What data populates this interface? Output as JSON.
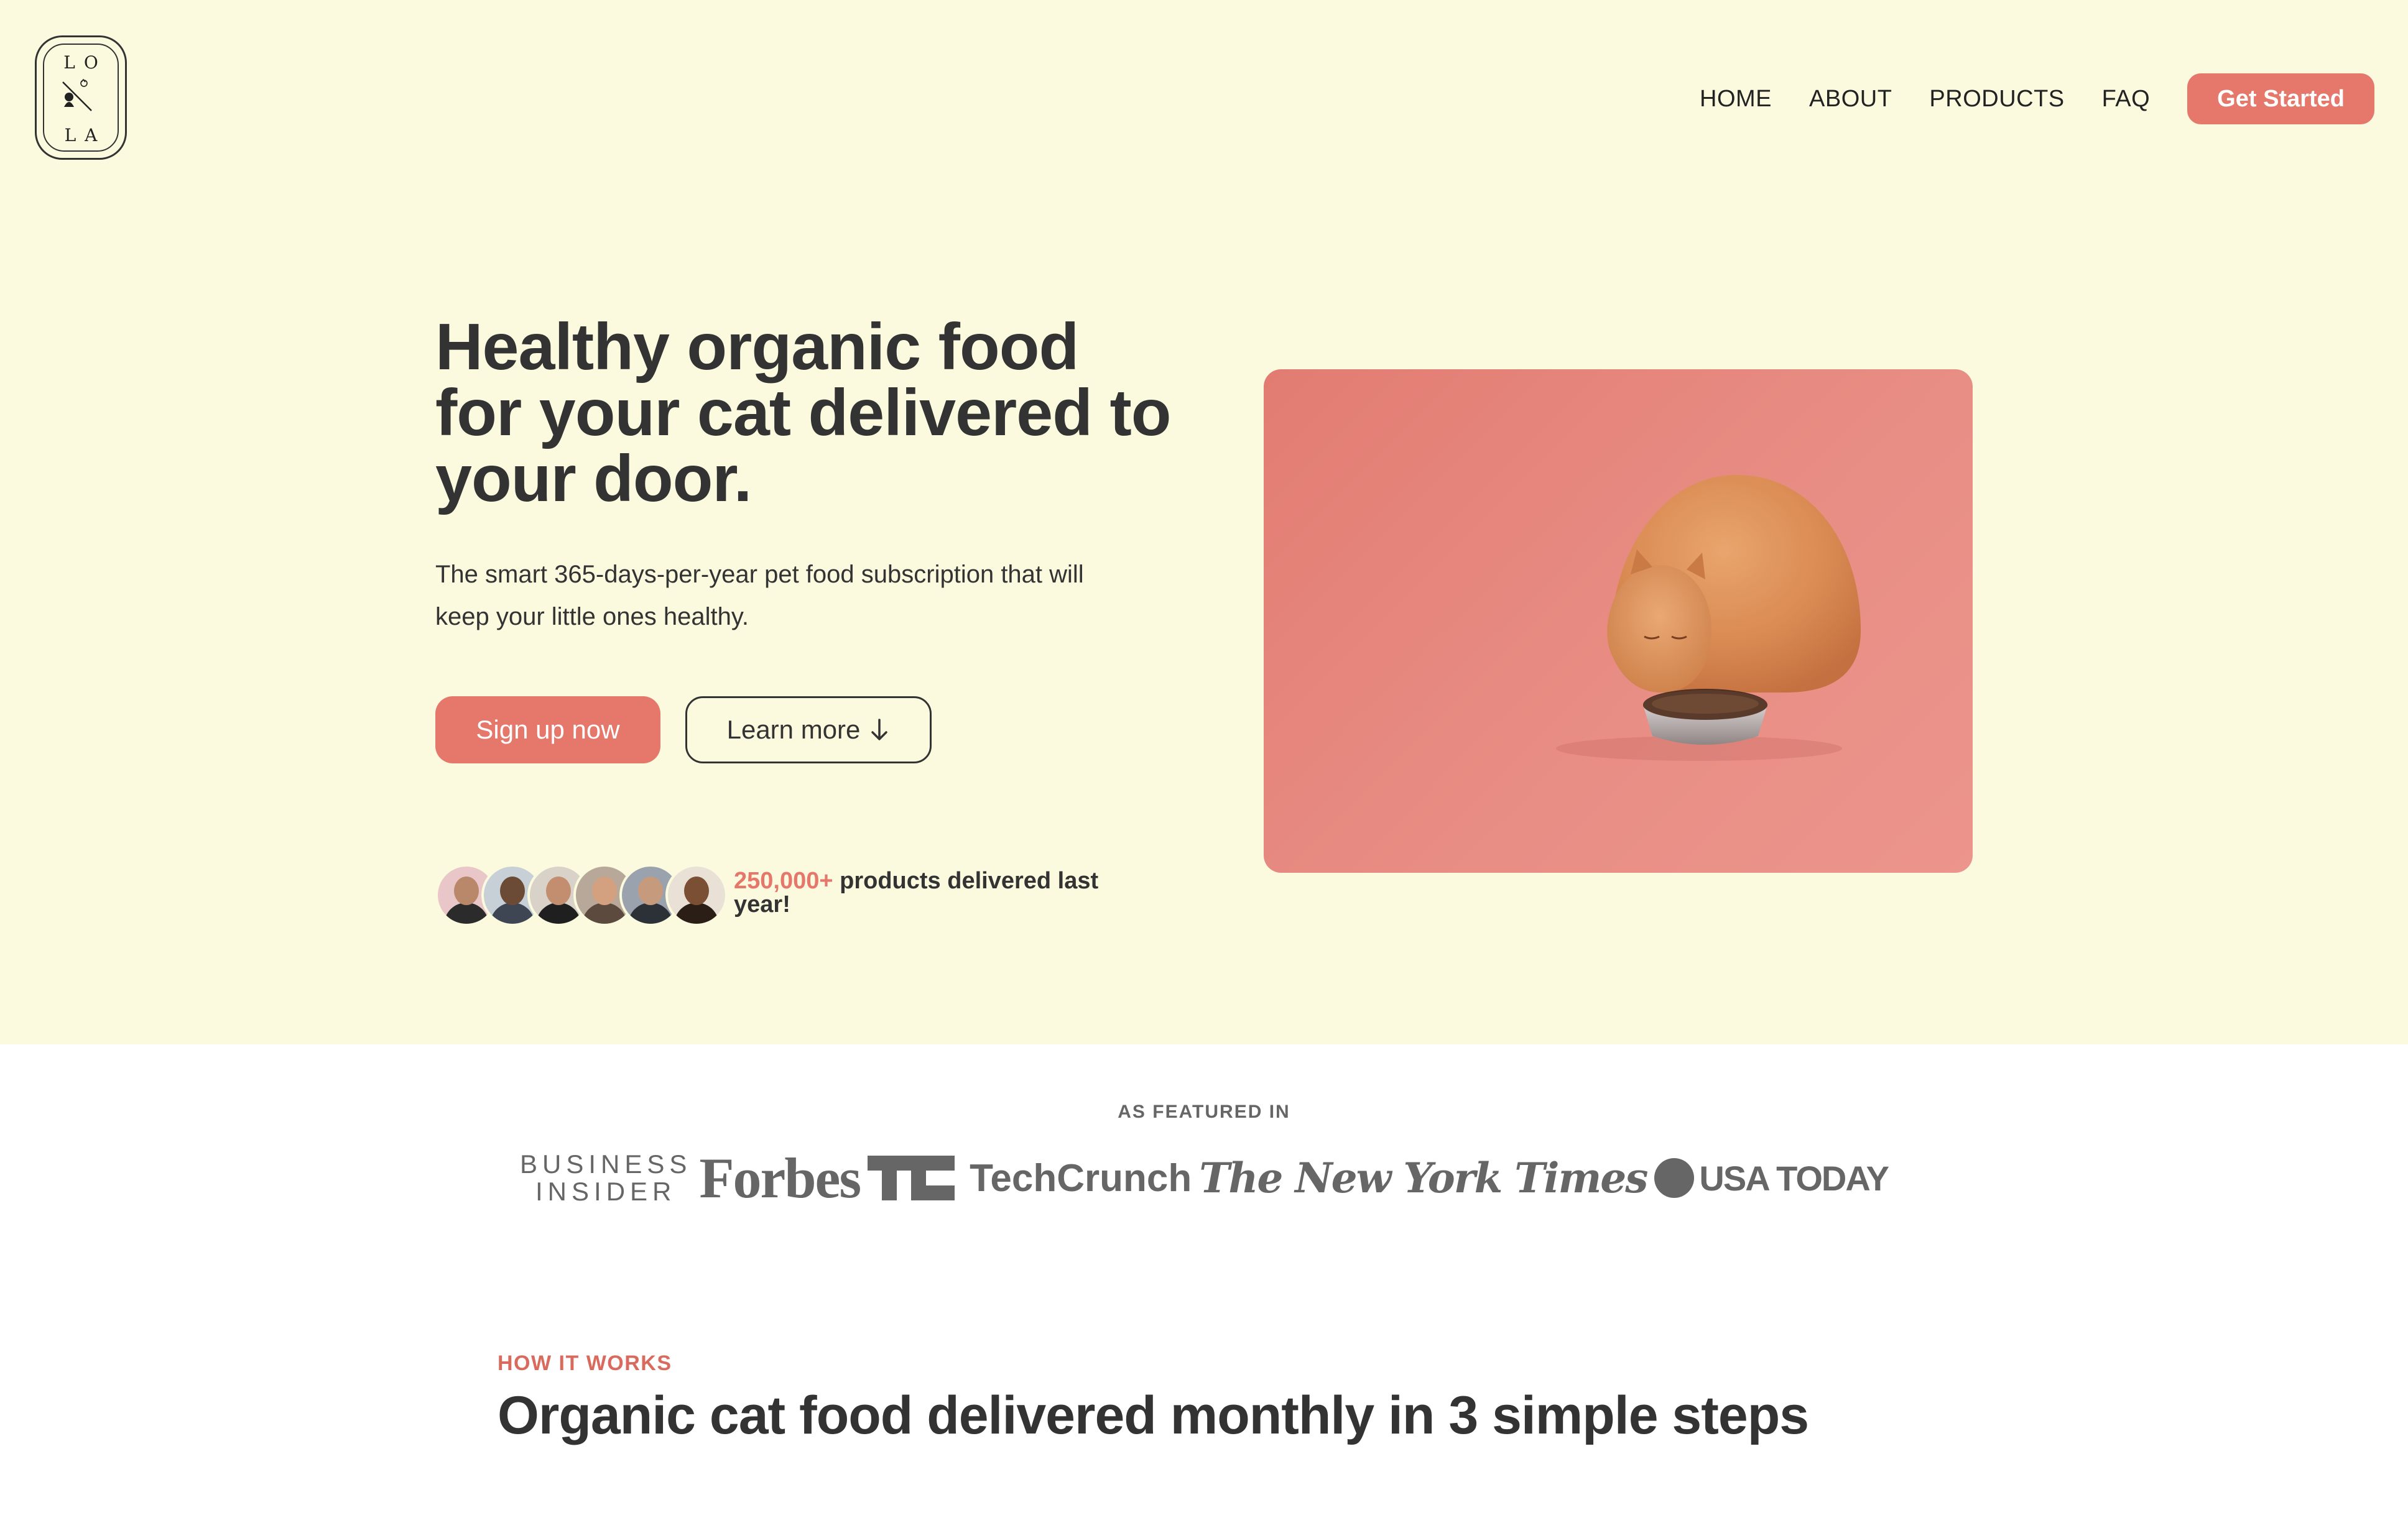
{
  "logo": {
    "top_letters": "LO",
    "bottom_letters": "LA"
  },
  "nav": {
    "items": [
      "HOME",
      "ABOUT",
      "PRODUCTS",
      "FAQ"
    ],
    "cta_label": "Get Started"
  },
  "hero": {
    "headline": "Healthy organic food for your cat delivered to your door.",
    "subtext": "The smart 365-days-per-year pet food subscription that will keep your little ones healthy.",
    "primary_button": "Sign up now",
    "secondary_button": "Learn more",
    "secondary_button_icon": "arrow-down-icon",
    "delivered_count": "250,000+",
    "delivered_text": "products delivered last year!",
    "image_icon": "cat-eating-photo"
  },
  "featured": {
    "label": "AS FEATURED IN",
    "logos": {
      "business_insider_line1": "BUSINESS",
      "business_insider_line2": "INSIDER",
      "forbes": "Forbes",
      "techcrunch": "TechCrunch",
      "nyt": "The New York Times",
      "usa_today": "USA TODAY"
    }
  },
  "how_it_works": {
    "eyebrow": "HOW IT WORKS",
    "title": "Organic cat food delivered monthly in 3 simple steps"
  },
  "colors": {
    "accent": "#e5776b",
    "hero_bg": "#fbfade",
    "text": "#333333",
    "muted": "#666666"
  }
}
